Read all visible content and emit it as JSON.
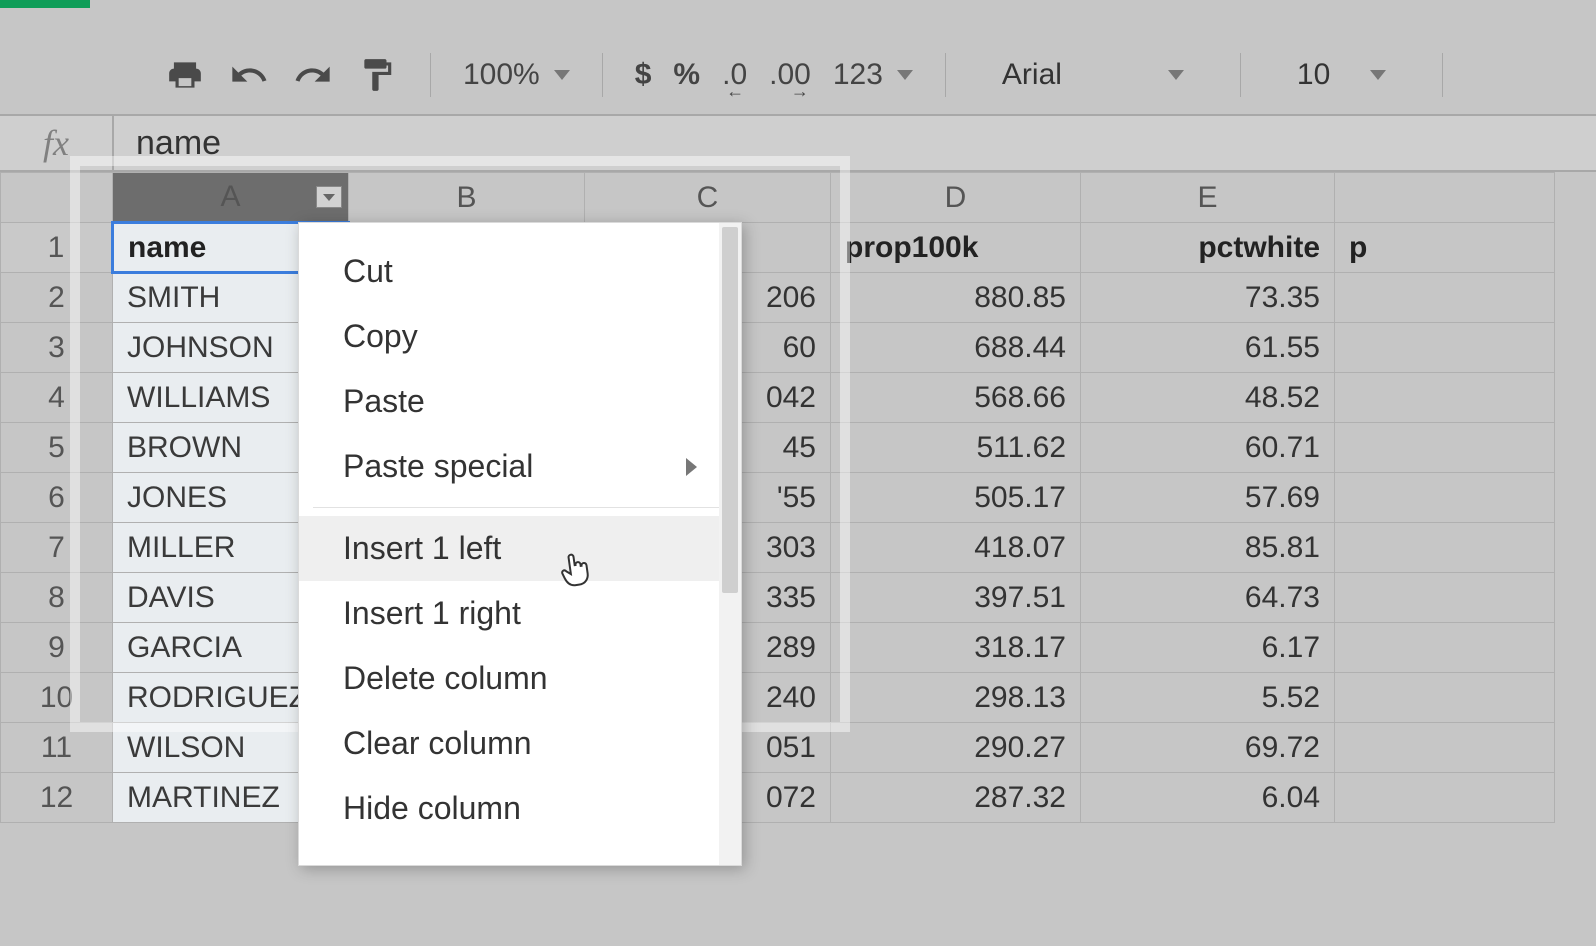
{
  "toolbar": {
    "zoom": "100%",
    "currency_glyph": "$",
    "percent_glyph": "%",
    "dec_decrease": ".0",
    "dec_increase": ".00",
    "format_label": "123",
    "font_name": "Arial",
    "font_size": "10"
  },
  "formula_bar": {
    "fx_label": "fx",
    "value": "name"
  },
  "columns": [
    "A",
    "B",
    "C",
    "D",
    "E"
  ],
  "row_numbers": [
    "1",
    "2",
    "3",
    "4",
    "5",
    "6",
    "7",
    "8",
    "9",
    "10",
    "11",
    "12"
  ],
  "headers_row": {
    "A": "name",
    "D": "prop100k",
    "E": "pctwhite"
  },
  "data_rows": [
    {
      "A": "SMITH",
      "C_peek": "206",
      "D": "880.85",
      "E": "73.35"
    },
    {
      "A": "JOHNSON",
      "C_peek": "60",
      "D": "688.44",
      "E": "61.55"
    },
    {
      "A": "WILLIAMS",
      "C_peek": "042",
      "D": "568.66",
      "E": "48.52"
    },
    {
      "A": "BROWN",
      "C_peek": "45",
      "D": "511.62",
      "E": "60.71"
    },
    {
      "A": "JONES",
      "C_peek": "'55",
      "D": "505.17",
      "E": "57.69"
    },
    {
      "A": "MILLER",
      "C_peek": "303",
      "D": "418.07",
      "E": "85.81"
    },
    {
      "A": "DAVIS",
      "C_peek": "335",
      "D": "397.51",
      "E": "64.73"
    },
    {
      "A": "GARCIA",
      "C_peek": "289",
      "D": "318.17",
      "E": "6.17"
    },
    {
      "A": "RODRIGUEZ",
      "C_peek": "240",
      "D": "298.13",
      "E": "5.52"
    },
    {
      "A": "WILSON",
      "C_peek": "051",
      "D": "290.27",
      "E": "69.72"
    },
    {
      "A": "MARTINEZ",
      "C_peek": "072",
      "D": "287.32",
      "E": "6.04"
    }
  ],
  "context_menu": {
    "cut": "Cut",
    "copy": "Copy",
    "paste": "Paste",
    "paste_special": "Paste special",
    "insert_left": "Insert 1 left",
    "insert_right": "Insert 1 right",
    "delete_col": "Delete column",
    "clear_col": "Clear column",
    "hide_col": "Hide column"
  }
}
